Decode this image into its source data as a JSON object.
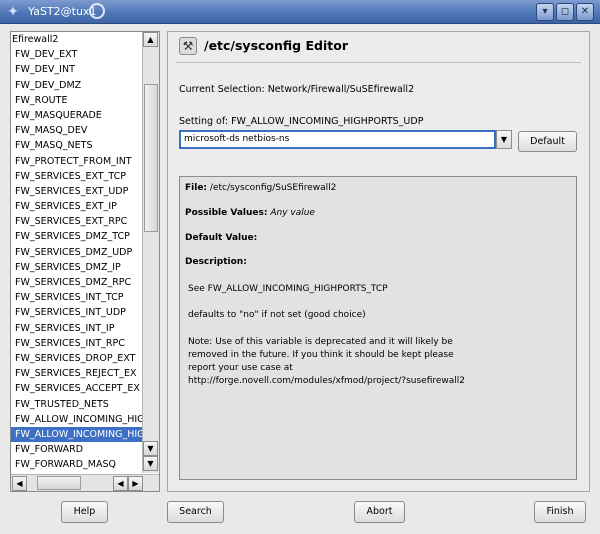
{
  "window": {
    "title": "YaST2@tux1",
    "buttons": [
      "▾",
      "◻",
      "✕"
    ]
  },
  "sidebar": {
    "items": [
      "Efirewall2",
      "FW_DEV_EXT",
      "FW_DEV_INT",
      "FW_DEV_DMZ",
      "FW_ROUTE",
      "FW_MASQUERADE",
      "FW_MASQ_DEV",
      "FW_MASQ_NETS",
      "FW_PROTECT_FROM_INT",
      "FW_SERVICES_EXT_TCP",
      "FW_SERVICES_EXT_UDP",
      "FW_SERVICES_EXT_IP",
      "FW_SERVICES_EXT_RPC",
      "FW_SERVICES_DMZ_TCP",
      "FW_SERVICES_DMZ_UDP",
      "FW_SERVICES_DMZ_IP",
      "FW_SERVICES_DMZ_RPC",
      "FW_SERVICES_INT_TCP",
      "FW_SERVICES_INT_UDP",
      "FW_SERVICES_INT_IP",
      "FW_SERVICES_INT_RPC",
      "FW_SERVICES_DROP_EXT",
      "FW_SERVICES_REJECT_EX",
      "FW_SERVICES_ACCEPT_EX",
      "FW_TRUSTED_NETS",
      "FW_ALLOW_INCOMING_HIG",
      "FW_ALLOW_INCOMING_HIG",
      "FW_FORWARD",
      "FW_FORWARD_MASQ"
    ],
    "selected_index": 26,
    "scroll_up": "▲",
    "scroll_down": "▼",
    "scroll_left": "◀",
    "scroll_right": "▶"
  },
  "editor": {
    "title": "/etc/sysconfig Editor",
    "current_selection": "Current Selection: Network/Firewall/SuSEfirewall2",
    "setting_of": "Setting of: FW_ALLOW_INCOMING_HIGHPORTS_UDP",
    "value": "microsoft-ds netbios-ns",
    "combo_arrow": "▼",
    "default_button": "Default"
  },
  "info": {
    "file_label": "File:",
    "file_value": "/etc/sysconfig/SuSEfirewall2",
    "possible_label": "Possible Values:",
    "possible_value": "Any value",
    "default_label": "Default Value:",
    "description_label": "Description:",
    "description_lines": [
      "See FW_ALLOW_INCOMING_HIGHPORTS_TCP",
      "defaults to \"no\" if not set (good choice)",
      "Note: Use of this variable is deprecated and it will likely be",
      "removed in the future. If you think it should be kept please",
      "report your use case at",
      "http://forge.novell.com/modules/xfmod/project/?susefirewall2"
    ]
  },
  "bottom": {
    "help": "Help",
    "search": "Search",
    "abort": "Abort",
    "finish": "Finish"
  },
  "colors": {
    "selection": "#3d6fc4",
    "titlebar": "#5077b8"
  },
  "icons": {
    "app": "yast-app-icon",
    "editor": "wrench-icon"
  }
}
